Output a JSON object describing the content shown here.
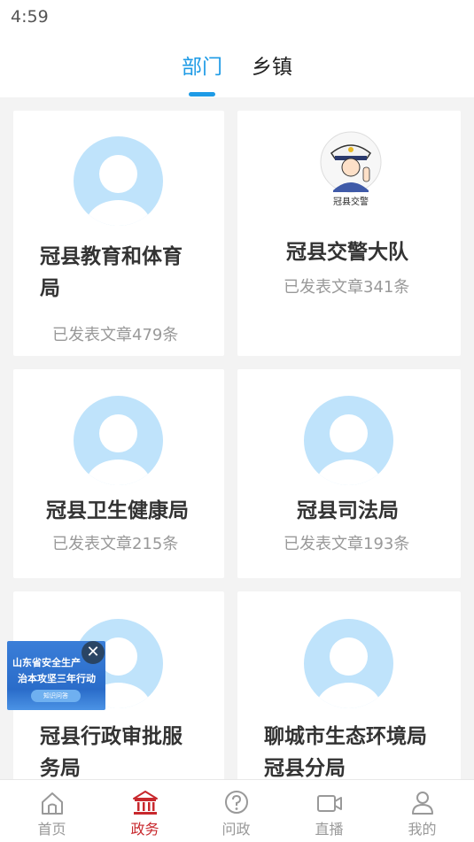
{
  "status_bar": {
    "time": "4:59"
  },
  "tabs": [
    {
      "label": "部门",
      "active": true
    },
    {
      "label": "乡镇",
      "active": false
    }
  ],
  "cards": [
    {
      "title_line1": "冠县教育和体育",
      "title_line2": "局",
      "count": "已发表文章479条",
      "avatar": "default-avatar"
    },
    {
      "title_line1": "冠县交警大队",
      "title_line2": "",
      "count": "已发表文章341条",
      "avatar": "traffic-police-logo",
      "logo_text": "冠县交警"
    },
    {
      "title_line1": "冠县卫生健康局",
      "title_line2": "",
      "count": "已发表文章215条",
      "avatar": "default-avatar"
    },
    {
      "title_line1": "冠县司法局",
      "title_line2": "",
      "count": "已发表文章193条",
      "avatar": "default-avatar"
    },
    {
      "title_line1": "冠县行政审批服",
      "title_line2": "务局",
      "count": "",
      "avatar": "default-avatar"
    },
    {
      "title_line1": "聊城市生态环境局",
      "title_line2": "冠县分局",
      "count": "",
      "avatar": "default-avatar"
    }
  ],
  "floating_ad": {
    "line1": "山东省安全生产",
    "line2": "治本攻坚三年行动",
    "button": "知识问答"
  },
  "bottom_nav": [
    {
      "label": "首页",
      "icon": "home-icon",
      "active": false
    },
    {
      "label": "政务",
      "icon": "government-building-icon",
      "active": true
    },
    {
      "label": "问政",
      "icon": "question-icon",
      "active": false
    },
    {
      "label": "直播",
      "icon": "video-camera-icon",
      "active": false
    },
    {
      "label": "我的",
      "icon": "user-icon",
      "active": false
    }
  ],
  "colors": {
    "accent_blue": "#1e9be6",
    "active_red": "#c8282d",
    "avatar_bg": "#bfe3fb",
    "page_bg": "#f3f3f3"
  }
}
